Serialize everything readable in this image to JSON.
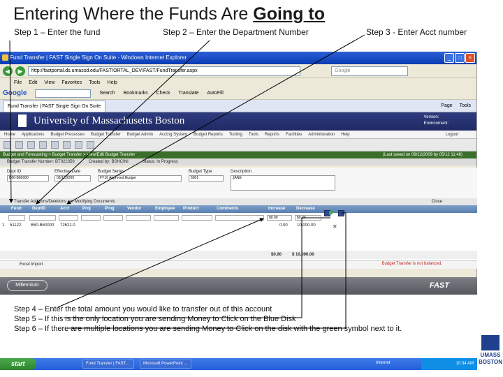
{
  "slide": {
    "title_prefix": "Entering Where the Funds Are ",
    "title_emphasis": "Going to",
    "step1": "Step 1 – Enter the fund",
    "step2": "Step 2 – Enter the Department Number",
    "step3": "Step 3 - Enter Acct number",
    "step4": "Step 4 – Enter the total amount you would like to transfer out of this account",
    "step5": "Step 5 – If this is the only location you are sending Money to Click on the Blue Disk",
    "step6": "Step 6 – If there are multiple locations you are sending Money to Click on the disk with the green symbol next to it.",
    "logo_line1": "UMASS",
    "logo_line2": "BOSTON"
  },
  "browser": {
    "window_title": "Fund Transfer | FAST Single Sign On Suite - Windows Internet Explorer",
    "address": "http://fastportal.ds.umassd.edu/FAST/ORTAL_DEV/FAST/FundTransfer.aspx",
    "search_placeholder": "Google",
    "menu": [
      "File",
      "Edit",
      "View",
      "Favorites",
      "Tools",
      "Help"
    ],
    "toolbar": {
      "google": "Google",
      "search": "Search",
      "bookmarks": "Bookmarks",
      "check": "Check",
      "translate": "Translate",
      "autofill": "AutoFill"
    },
    "tab_label": "Fund Transfer | FAST Single Sign On Suite",
    "tab_tools": [
      "Page",
      "Tools"
    ]
  },
  "app": {
    "university": "University of Massachusetts Boston",
    "version_label": "Version:",
    "environment_label": "Environment:",
    "menu": [
      "Home",
      "Applications",
      "Budget Processes",
      "Budget Transfer",
      "Budget Admin",
      "Acctng System",
      "Budget Reports",
      "Tooling",
      "Tools",
      "Reports",
      "Facilities",
      "Administration",
      "Help"
    ],
    "logout": "Logout",
    "breadcrumb": "Budget and Forecasting > Budget Transfer > View/Edit Budget Transfer",
    "last_saved": "(Last saved on 09/12/2009 by 05/12 11:48)",
    "transfer_number_label": "Budget Transfer Number:",
    "transfer_number": "BT022359",
    "created_by_label": "Created by:",
    "created_by": "BSHCINI",
    "status_label": "Status:",
    "status": "In Progress",
    "form": {
      "dept_label": "Dept ID",
      "dept_value": "B60-B60000",
      "eff_date_label": "Effective Date",
      "eff_date_value": "09/12/2009",
      "series_label": "Budget Series",
      "series_value": "FY10 Approved Budget",
      "type_label": "Budget Type",
      "type_value": "5001",
      "desc_label": "Description",
      "desc_value": "JANE"
    },
    "details_header": "Transfer Additions/Deletions are Modifying Documents",
    "close_label": "Close",
    "grid_headers": [
      "Fund",
      "DeptID",
      "Acct",
      "Proj",
      "Prog",
      "Vendor",
      "Employee",
      "Product",
      "Comments",
      "Increase",
      "Decrease"
    ],
    "new_row": {
      "increase": "$0.00",
      "decrease": "$0.00"
    },
    "row": {
      "num": "1",
      "fund": "51122",
      "dept": "B60-B60000",
      "acct": "72621.0",
      "increase": "0.00",
      "decrease": "10,000.00"
    },
    "totals": {
      "increase": "$0.00",
      "decrease": "$ 10,000.00"
    },
    "excel_label": "Excel Import",
    "balance_msg": "Budget Transfer is not balanced.",
    "millennium": "Millennium",
    "fast_brand": "FAST"
  },
  "taskbar": {
    "start": "start",
    "tasks": [
      "Fund Transfer | FAST...",
      "Microsoft PowerPoint ..."
    ],
    "network": "Internet",
    "clock": "10:34 AM"
  }
}
